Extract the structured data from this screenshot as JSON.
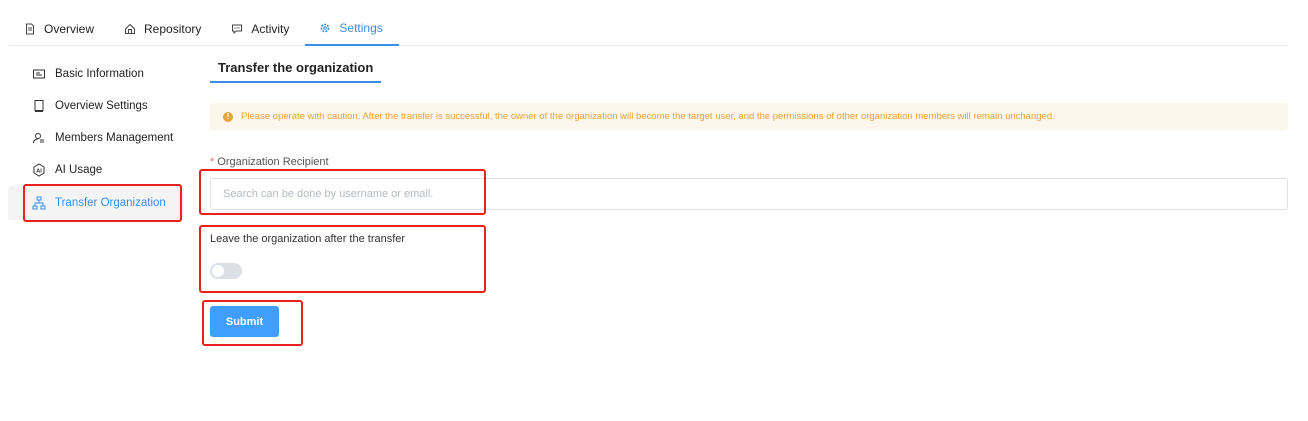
{
  "tabs": [
    {
      "label": "Overview",
      "icon": "document-icon"
    },
    {
      "label": "Repository",
      "icon": "repository-icon"
    },
    {
      "label": "Activity",
      "icon": "chat-icon"
    },
    {
      "label": "Settings",
      "icon": "gear-icon",
      "active": true
    }
  ],
  "sidebar": {
    "items": [
      {
        "label": "Basic Information",
        "icon": "id-card-icon"
      },
      {
        "label": "Overview Settings",
        "icon": "book-icon"
      },
      {
        "label": "Members Management",
        "icon": "members-icon"
      },
      {
        "label": "AI Usage",
        "icon": "ai-icon"
      },
      {
        "label": "Transfer Organization",
        "icon": "org-chart-icon",
        "active": true
      }
    ]
  },
  "main": {
    "title": "Transfer the organization",
    "warning": "Please operate with caution. After the transfer is successful, the owner of the organization will become the target user, and the permissions of other organization members will remain unchanged.",
    "recipient_label": "Organization Recipient",
    "required_mark": "*",
    "recipient_placeholder": "Search can be done by username or email.",
    "recipient_value": "",
    "leave_label": "Leave the organization after the transfer",
    "leave_enabled": false,
    "submit_label": "Submit"
  },
  "colors": {
    "accent": "#3a8ee6",
    "button": "#409eff",
    "warning_text": "#e6a23c",
    "warning_bg": "#fdf6ec",
    "annotation": "#e8201e"
  }
}
